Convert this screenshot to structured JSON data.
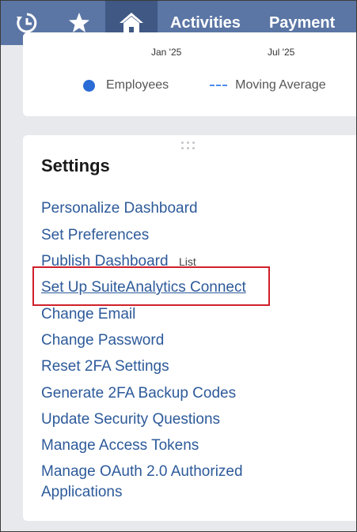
{
  "nav": {
    "recent_icon": "recent-history-icon",
    "star_icon": "star-icon",
    "home_icon": "home-icon",
    "tabs": [
      "Activities",
      "Payment"
    ]
  },
  "chart": {
    "ticks": [
      "Jan '25",
      "Jul '25"
    ],
    "legend": {
      "series1": "Employees",
      "series2": "Moving Average"
    },
    "colors": {
      "employees": "#2b6bd6",
      "moving_average": "#4a8df0"
    }
  },
  "settings": {
    "title": "Settings",
    "links": [
      "Personalize Dashboard",
      "Set Preferences",
      "Publish Dashboard",
      "Set Up SuiteAnalytics Connect",
      "Change Email",
      "Change Password",
      "Reset 2FA Settings",
      "Generate 2FA Backup Codes",
      "Update Security Questions",
      "Manage Access Tokens",
      "Manage OAuth 2.0 Authorized",
      "Applications"
    ],
    "publish_tag": "List"
  }
}
